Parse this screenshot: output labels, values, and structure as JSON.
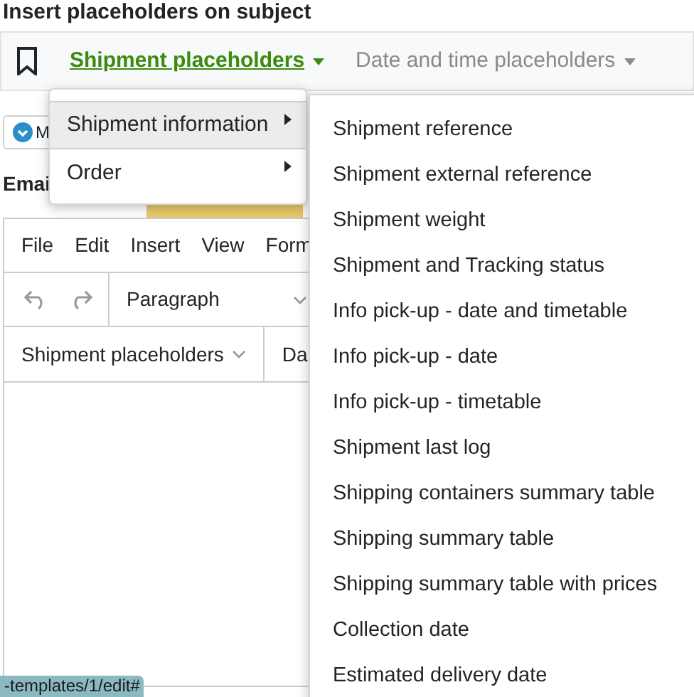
{
  "heading": "Insert placeholders on subject",
  "placeholder_tabs": [
    {
      "label": "Shipment placeholders",
      "selected": true
    },
    {
      "label": "Date and time placeholders",
      "selected": false
    }
  ],
  "status_button": {
    "label": "M"
  },
  "email_label": "Emai",
  "editor": {
    "menu": [
      "File",
      "Edit",
      "Insert",
      "View",
      "Form"
    ],
    "block_format": "Paragraph",
    "placeholder_menus": [
      "Shipment placeholders",
      "Da"
    ]
  },
  "menu": [
    {
      "label": "Shipment information",
      "selected": true
    },
    {
      "label": "Order",
      "selected": false
    }
  ],
  "submenu": [
    "Shipment reference",
    "Shipment external reference",
    "Shipment weight",
    "Shipment and Tracking status",
    "Info pick-up - date and timetable",
    "Info pick-up - date",
    "Info pick-up - timetable",
    "Shipment last log",
    "Shipping containers summary table",
    "Shipping summary table",
    "Shipping summary table with prices",
    "Collection date",
    "Estimated delivery date"
  ],
  "status_url": "-templates/1/edit#"
}
